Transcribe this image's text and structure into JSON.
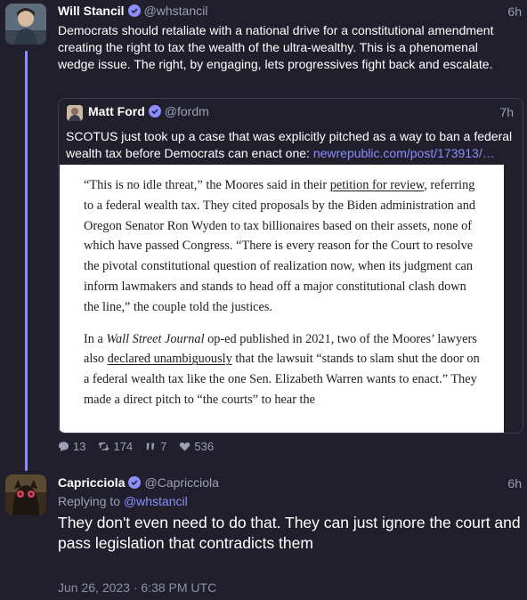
{
  "post": {
    "display_name": "Will Stancil",
    "handle": "@whstancil",
    "time": "6h",
    "text": "Democrats should retaliate with a national drive for a constitutional amendment creating the right to tax the wealth of the ultra-wealthy. This is a phenomenal wedge issue. The right, by engaging, lets progressives fight back and escalate.",
    "quote": {
      "display_name": "Matt Ford",
      "handle": "@fordm",
      "time": "7h",
      "text": "SCOTUS just took up a case that was explicitly pitched as a way to ban a federal wealth tax before Democrats can enact one: ",
      "link": "newrepublic.com/post/173913/…",
      "article": {
        "p1_a": "“This is no idle threat,” the Moores said in their ",
        "p1_link": "petition for review",
        "p1_b": ", referring to a federal wealth tax. They cited proposals by the Biden administration and Oregon Senator Ron Wyden to tax billionaires based on their assets, none of which have passed Congress. “There is every reason for the Court to resolve the pivotal constitutional question of realization now, when its judgment can inform lawmakers and stands to head off a major constitutional clash down the line,” the couple told the justices.",
        "p2_a": "In a ",
        "p2_italic": "Wall Street Journal",
        "p2_b": " op-ed published in 2021, two of the Moores’ lawyers also ",
        "p2_link": "declared unambiguously",
        "p2_c": " that the lawsuit “stands to slam shut the door on a federal wealth tax like the one Sen. Elizabeth Warren wants to enact.” They made a direct pitch to “the courts” to hear the"
      }
    },
    "stats": {
      "replies": "13",
      "reposts": "174",
      "quotes": "7",
      "likes": "536"
    }
  },
  "reply": {
    "display_name": "Capricciola",
    "handle": "@Capricciola",
    "time": "6h",
    "replying_label": "Replying to ",
    "replying_to": "@whstancil",
    "text": "They don't even need to do that. They can just ignore the court and pass legislation that contradicts them",
    "date": "Jun 26, 2023 · 6:38 PM UTC"
  },
  "colors": {
    "background": "#211f2c",
    "accent": "#8c8dff",
    "muted": "#9aa0b5"
  }
}
